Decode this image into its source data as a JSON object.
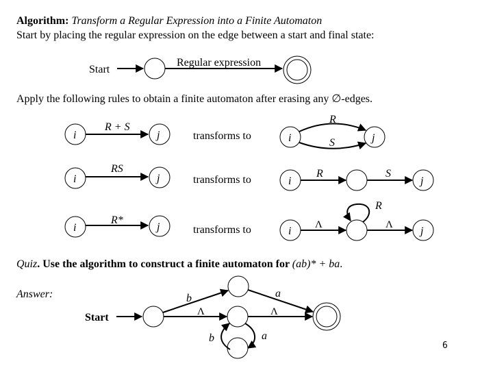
{
  "header": {
    "algorithm_label": "Algorithm:",
    "algorithm_title": "Transform a Regular Expression into a Finite Automaton",
    "intro": "Start by placing the regular expression on the edge between a start and final state:"
  },
  "initial_diagram": {
    "start_label": "Start",
    "edge_label": "Regular expression"
  },
  "rules_intro": "Apply the following rules to obtain a finite automaton after erasing any ∅-edges.",
  "rules": [
    {
      "left": {
        "from": "i",
        "to": "j",
        "label": "R + S"
      },
      "connector": "transforms to",
      "right": {
        "from": "i",
        "to": "j",
        "top_label": "R",
        "bottom_label": "S"
      }
    },
    {
      "left": {
        "from": "i",
        "to": "j",
        "label": "RS"
      },
      "connector": "transforms to",
      "right": {
        "from": "i",
        "to": "j",
        "first_label": "R",
        "second_label": "S"
      }
    },
    {
      "left": {
        "from": "i",
        "to": "j",
        "label": "R*"
      },
      "connector": "transforms to",
      "right": {
        "from": "i",
        "to": "j",
        "in_label": "Λ",
        "loop_label": "R",
        "out_label": "Λ"
      }
    }
  ],
  "quiz": {
    "label": "Quiz",
    "text": ". Use the algorithm to construct a finite automaton for ",
    "expression": "(ab)* + ba",
    "period": "."
  },
  "answer": {
    "label": "Answer:",
    "start_label": "Start",
    "edges": {
      "start_to_top": "b",
      "top_to_final": "a",
      "start_to_mid": "Λ",
      "mid_to_final": "Λ",
      "mid_to_bottom": "a",
      "bottom_to_mid": "b"
    }
  },
  "page_number": "6"
}
